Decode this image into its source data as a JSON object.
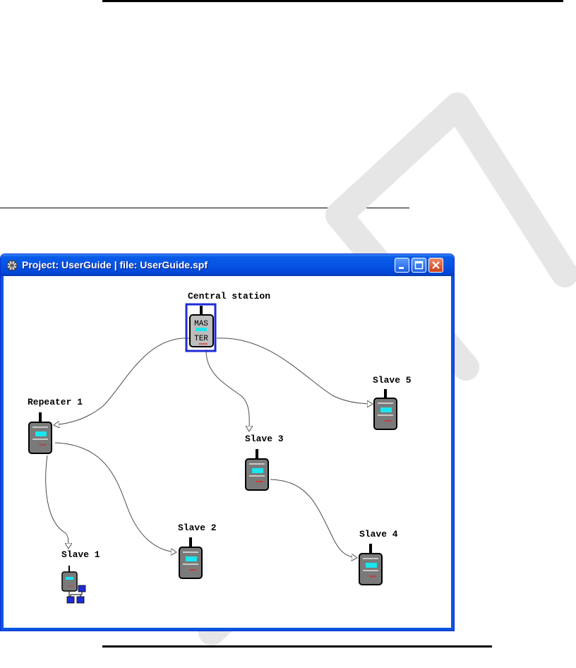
{
  "window": {
    "title": "Project: UserGuide | file: UserGuide.spf"
  },
  "nodes": {
    "central": {
      "label": "Central station",
      "badge_top": "MAS",
      "badge_bottom": "TER"
    },
    "repeater1": {
      "label": "Repeater 1"
    },
    "slave1": {
      "label": "Slave 1"
    },
    "slave2": {
      "label": "Slave 2"
    },
    "slave3": {
      "label": "Slave 3"
    },
    "slave4": {
      "label": "Slave 4"
    },
    "slave5": {
      "label": "Slave 5"
    }
  },
  "colors": {
    "selection_frame": "#1f2bd6",
    "device_body": "#7a7a7a",
    "device_screen": "#19e6f0",
    "device_leds": "#e0201e",
    "link": "#4a4a4a",
    "watermark": "#e6e6e6",
    "titlebar": "#0653e4"
  }
}
